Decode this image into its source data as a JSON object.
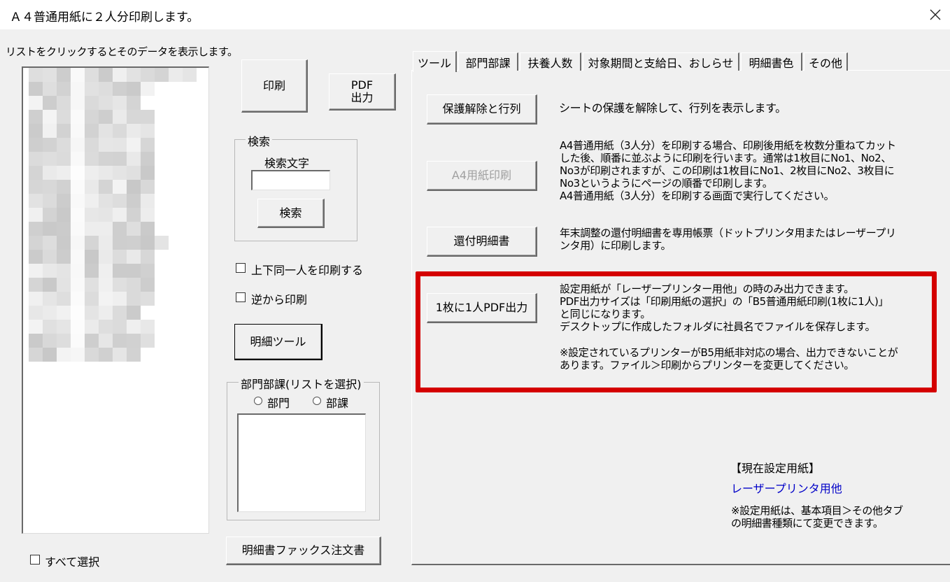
{
  "window": {
    "title": "Ａ４普通用紙に２人分印刷します。",
    "close_icon": "close-icon"
  },
  "left": {
    "hint": "リストをクリックするとそのデータを表示します。",
    "select_all_label": "すべて選択",
    "select_all_checked": false
  },
  "middle": {
    "print_label": "印刷",
    "pdf_output_label": "PDF\n出力",
    "search_group_title": "検索",
    "search_text_label": "検索文字",
    "search_input_value": "",
    "search_button_label": "検索",
    "same_person_label": "上下同一人を印刷する",
    "same_person_checked": false,
    "reverse_label": "逆から印刷",
    "reverse_checked": false,
    "detail_tool_label": "明細ツール",
    "dept_group_title": "部門部課(リストを選択)",
    "radio_dept_label": "部門",
    "radio_section_label": "部課",
    "fax_order_label": "明細書ファックス注文書"
  },
  "tabs": [
    {
      "label": "ツール",
      "active": true
    },
    {
      "label": "部門部課",
      "active": false
    },
    {
      "label": "扶養人数",
      "active": false
    },
    {
      "label": "対象期間と支給日、おしらせ",
      "active": false
    },
    {
      "label": "明細書色",
      "active": false
    },
    {
      "label": "その他",
      "active": false
    }
  ],
  "tool": {
    "unprotect_label": "保護解除と行列",
    "unprotect_desc": "シートの保護を解除して、行列を表示します。",
    "a4_print_label": "A4用紙印刷",
    "a4_print_enabled": false,
    "a4_print_desc": "A4普通用紙（3人分）を印刷する場合、印刷後用紙を枚数分重ねてカット\nした後、順番に並ぶように印刷を行います。通常は1枚目にNo1、No2、\nNo3が印刷されますが、この印刷は1枚目にNo1、2枚目にNo2、3枚目に\nNo3というようにページの順番で印刷します。\nA4普通用紙（3人分）を印刷する画面で実行してください。",
    "refund_label": "還付明細書",
    "refund_desc": "年末調整の還付明細書を専用帳票（ドットプリンタ用またはレーザープリ\nンタ用）に印刷します。",
    "pdf_per_person_label": "1枚に1人PDF出力",
    "pdf_per_person_desc": "設定用紙が「レーザープリンター用他」の時のみ出力できます。\nPDF出力サイズは「印刷用紙の選択」の「B5普通用紙印刷(1枚に1人)」\nと同じになります。\nデスクトップに作成したフォルダに社員名でファイルを保存します。",
    "pdf_per_person_note": "※設定されているプリンターがB5用紙非対応の場合、出力できないことが\nあります。ファイル＞印刷からプリンターを変更してください。",
    "highlight_color": "#d40000"
  },
  "paper": {
    "heading": "【現在設定用紙】",
    "current": "レーザープリンタ用他",
    "current_color": "#0000c8",
    "note": "※設定用紙は、基本項目＞その他タブ\nの明細書種類にて変更できます。"
  }
}
